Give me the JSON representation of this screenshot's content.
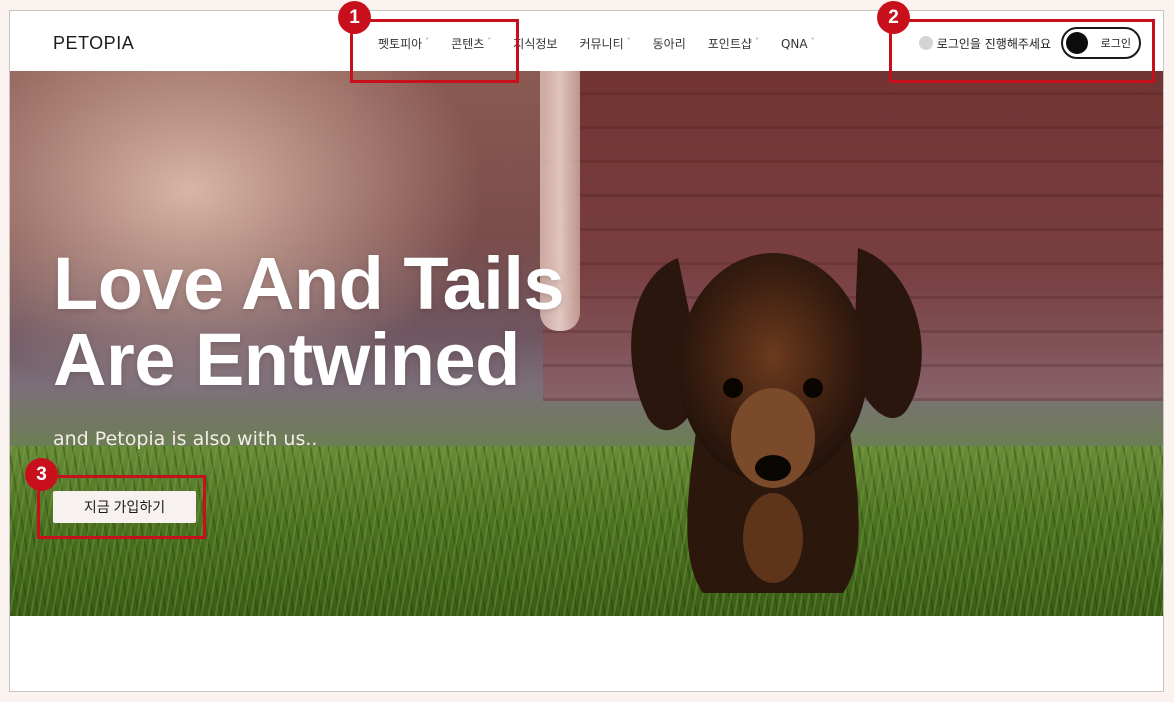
{
  "brand": {
    "logo_text": "PETOPIA"
  },
  "nav": {
    "items": [
      {
        "label": "펫토피아",
        "has_dropdown": true
      },
      {
        "label": "콘텐츠",
        "has_dropdown": true
      },
      {
        "label": "지식정보",
        "has_dropdown": false
      },
      {
        "label": "커뮤니티",
        "has_dropdown": true
      },
      {
        "label": "동아리",
        "has_dropdown": false
      },
      {
        "label": "포인트샵",
        "has_dropdown": true
      },
      {
        "label": "QNA",
        "has_dropdown": true
      }
    ],
    "chevron": "˅"
  },
  "auth": {
    "message": "로그인을 진행해주세요",
    "toggle_label": "로그인",
    "status_color": "#d4d4d4"
  },
  "hero": {
    "title_line1": "Love And Tails",
    "title_line2": "Are Entwined",
    "subtitle": "and Petopia is also with us..",
    "cta_label": "지금 가입하기"
  },
  "annotations": [
    {
      "number": "1",
      "target": "nav-dropdown-menus"
    },
    {
      "number": "2",
      "target": "login-area"
    },
    {
      "number": "3",
      "target": "signup-button"
    }
  ],
  "colors": {
    "annotation_red": "#c8101d",
    "header_bg": "#ffffff",
    "page_bg": "#fbf3ef"
  }
}
